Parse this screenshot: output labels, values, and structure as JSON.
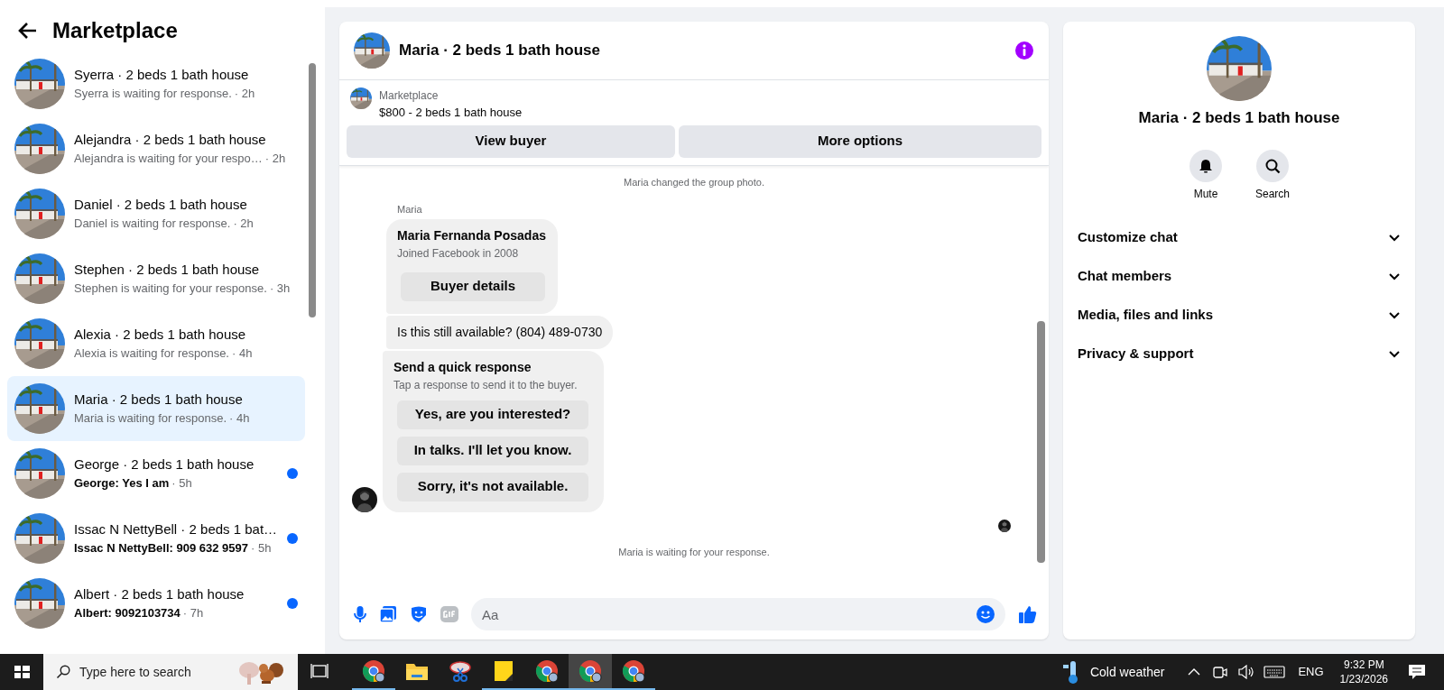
{
  "sidebar": {
    "title": "Marketplace",
    "conversations": [
      {
        "title": "Syerra · 2 beds 1 bath house",
        "preview": "Syerra is waiting for response.",
        "time": "· 2h",
        "unread": false,
        "selected": false
      },
      {
        "title": "Alejandra · 2 beds 1 bath house",
        "preview": "Alejandra is waiting for your respo…",
        "time": "· 2h",
        "unread": false,
        "selected": false
      },
      {
        "title": "Daniel · 2 beds 1 bath house",
        "preview": "Daniel is waiting for response.",
        "time": "· 2h",
        "unread": false,
        "selected": false
      },
      {
        "title": "Stephen · 2 beds 1 bath house",
        "preview": "Stephen is waiting for your response.",
        "time": "· 3h",
        "unread": false,
        "selected": false
      },
      {
        "title": "Alexia · 2 beds 1 bath house",
        "preview": "Alexia is waiting for response.",
        "time": "· 4h",
        "unread": false,
        "selected": false
      },
      {
        "title": "Maria · 2 beds 1 bath house",
        "preview": "Maria is waiting for response.",
        "time": "· 4h",
        "unread": false,
        "selected": true
      },
      {
        "title": "George · 2 beds 1 bath house",
        "preview": "George: Yes I am",
        "time": "· 5h",
        "unread": true,
        "selected": false
      },
      {
        "title": "Issac N NettyBell · 2 beds 1 bat…",
        "preview": "Issac N NettyBell: 909 632 9597",
        "time": "· 5h",
        "unread": true,
        "selected": false
      },
      {
        "title": "Albert · 2 beds 1 bath house",
        "preview": "Albert: 9092103734",
        "time": "· 7h",
        "unread": true,
        "selected": false
      }
    ]
  },
  "chat": {
    "title": "Maria · 2 beds 1 bath house",
    "listing": {
      "label": "Marketplace",
      "title": "$800 - 2 beds 1 bath house"
    },
    "buttons": [
      "View buyer",
      "More options"
    ],
    "event": "Maria changed the group photo.",
    "sender": "Maria",
    "buyer_card": {
      "name": "Maria Fernanda Posadas",
      "subtitle": "Joined Facebook in 2008",
      "button": "Buyer details"
    },
    "message": "Is this still available? (804) 489-0730",
    "quick_response": {
      "title": "Send a quick response",
      "subtitle": "Tap a response to send it to the buyer.",
      "options": [
        "Yes, are you interested?",
        "In talks. I'll let you know.",
        "Sorry, it's not available."
      ]
    },
    "status": "Maria is waiting for your response.",
    "composer": {
      "placeholder": "Aa"
    }
  },
  "details": {
    "title": "Maria · 2 beds 1 bath house",
    "actions": [
      {
        "label": "Mute",
        "kind": "bell"
      },
      {
        "label": "Search",
        "kind": "search"
      }
    ],
    "sections": [
      {
        "label": "Customize chat",
        "expanded": false
      },
      {
        "label": "Chat members",
        "expanded": false
      },
      {
        "label": "Media, files and links",
        "expanded": false
      },
      {
        "label": "Privacy & support",
        "expanded": false
      }
    ]
  },
  "taskbar": {
    "search": {
      "placeholder": "Type here to search"
    },
    "apps": [
      {
        "kind": "chrome",
        "running": true,
        "selected": false
      },
      {
        "kind": "files",
        "running": false,
        "selected": false
      },
      {
        "kind": "snip",
        "running": false,
        "selected": false
      },
      {
        "kind": "notes",
        "running": true,
        "selected": false
      },
      {
        "kind": "chrome",
        "running": true,
        "selected": false
      },
      {
        "kind": "chrome",
        "running": true,
        "selected": true
      },
      {
        "kind": "chrome",
        "running": true,
        "selected": false
      }
    ],
    "weather": "Cold weather",
    "language": "ENG",
    "time": "9:32 PM",
    "date": "1/23/2026"
  }
}
